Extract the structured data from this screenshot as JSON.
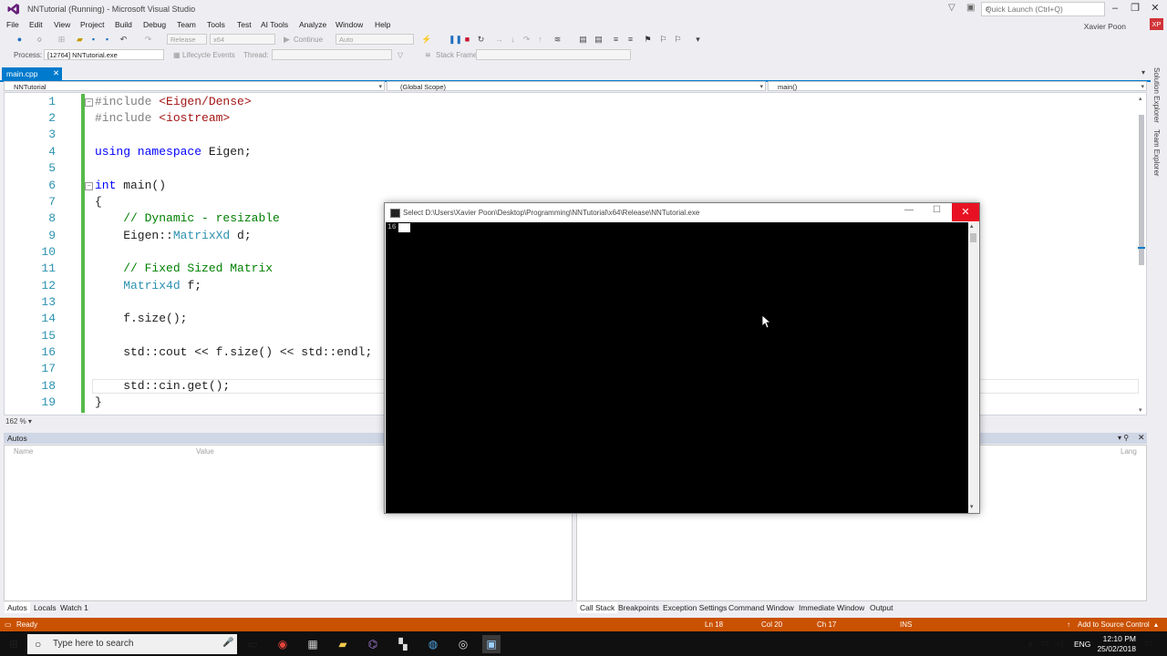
{
  "window": {
    "title": "NNTutorial (Running) - Microsoft Visual Studio",
    "quick_launch_placeholder": "Quick Launch (Ctrl+Q)",
    "user": "Xavier Poon",
    "avatar_initials": "XP"
  },
  "menu": [
    "File",
    "Edit",
    "View",
    "Project",
    "Build",
    "Debug",
    "Team",
    "Tools",
    "Test",
    "AI Tools",
    "Analyze",
    "Window",
    "Help"
  ],
  "toolbar": {
    "config": "Release",
    "platform": "x64",
    "continue_label": "Continue",
    "auto_label": "Auto",
    "process_label": "Process:",
    "process_value": "[12764] NNTutorial.exe",
    "lifecycle_label": "Lifecycle Events",
    "thread_label": "Thread:",
    "stack_frame_label": "Stack Frame:"
  },
  "tabs": [
    {
      "label": "main.cpp"
    }
  ],
  "nav": {
    "project": "NNTutorial",
    "scope": "(Global Scope)",
    "member": "main()"
  },
  "editor": {
    "line_numbers": [
      "1",
      "2",
      "3",
      "4",
      "5",
      "6",
      "7",
      "8",
      "9",
      "10",
      "11",
      "12",
      "13",
      "14",
      "15",
      "16",
      "17",
      "18",
      "19"
    ],
    "zoom": "162 %"
  },
  "side_tabs": [
    "Solution Explorer",
    "Team Explorer"
  ],
  "autos": {
    "title": "Autos",
    "columns": [
      "Name",
      "Value"
    ],
    "tabs": [
      "Autos",
      "Locals",
      "Watch 1"
    ]
  },
  "callstack": {
    "column_lang": "Lang",
    "tabs": [
      "Call Stack",
      "Breakpoints",
      "Exception Settings",
      "Command Window",
      "Immediate Window",
      "Output"
    ]
  },
  "console": {
    "title": "Select D:\\Users\\Xavier Poon\\Desktop\\Programming\\NNTutorial\\x64\\Release\\NNTutorial.exe",
    "output": "16"
  },
  "status": {
    "state": "Ready",
    "line": "Ln 18",
    "col": "Col 20",
    "ch": "Ch 17",
    "mode": "INS",
    "source_control": "Add to Source Control"
  },
  "taskbar": {
    "search_placeholder": "Type here to search",
    "lang": "ENG",
    "time": "12:10 PM",
    "date": "25/02/2018"
  },
  "colors": {
    "accent": "#007acc",
    "status_bar": "#ca5100",
    "close_red": "#e81123"
  }
}
